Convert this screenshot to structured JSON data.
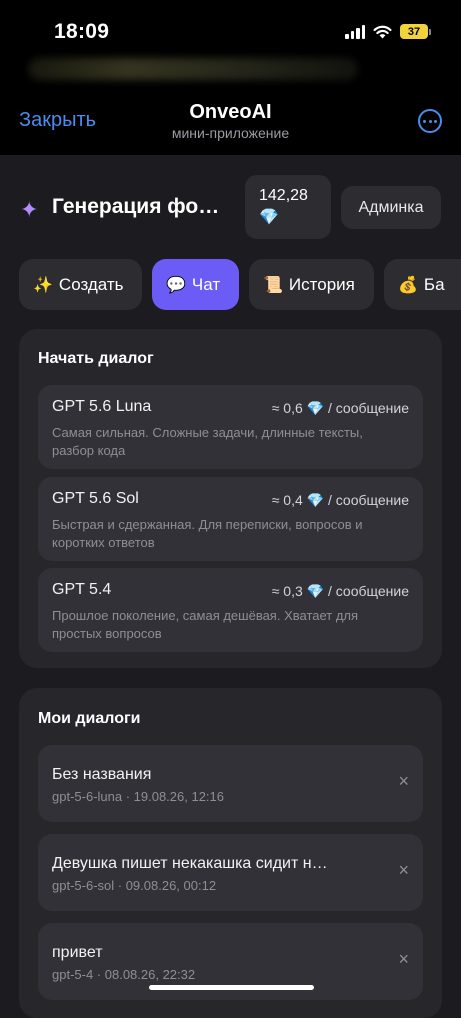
{
  "status": {
    "time": "18:09",
    "battery": "37"
  },
  "header": {
    "close_label": "Закрыть",
    "title": "OnveoAI",
    "subtitle": "мини-приложение"
  },
  "hero": {
    "title": "Генерация фо…",
    "balance_value": "142,28",
    "balance_icon": "💎",
    "admin_label": "Админка"
  },
  "tabs": [
    {
      "icon": "✨",
      "label": "Создать"
    },
    {
      "icon": "💬",
      "label": "Чат"
    },
    {
      "icon": "📜",
      "label": "История"
    },
    {
      "icon": "💰",
      "label": "Ба"
    }
  ],
  "start_dialog": {
    "title": "Начать диалог",
    "models": [
      {
        "name": "GPT 5.6 Luna",
        "price": "≈ 0,6 💎 / сообщение",
        "description": "Самая сильная. Сложные задачи, длинные тексты, разбор кода"
      },
      {
        "name": "GPT 5.6 Sol",
        "price": "≈ 0,4 💎 / сообщение",
        "description": "Быстрая и сдержанная. Для переписки, вопросов и коротких ответов"
      },
      {
        "name": "GPT 5.4",
        "price": "≈ 0,3 💎 / сообщение",
        "description": "Прошлое поколение, самая дешёвая. Хватает для простых вопросов"
      }
    ]
  },
  "my_dialogs": {
    "title": "Мои диалоги",
    "items": [
      {
        "title": "Без названия",
        "meta": "gpt-5-6-luna · 19.08.26, 12:16"
      },
      {
        "title": "Девушка пишет некакашка сидит н…",
        "meta": "gpt-5-6-sol · 09.08.26, 00:12"
      },
      {
        "title": "привет",
        "meta": "gpt-5-4 · 08.08.26, 22:32"
      }
    ],
    "delete_glyph": "×"
  },
  "colors": {
    "accent": "#6a5cf5",
    "link": "#4a8cf0",
    "background": "#1c1c20",
    "card": "#26262b"
  }
}
